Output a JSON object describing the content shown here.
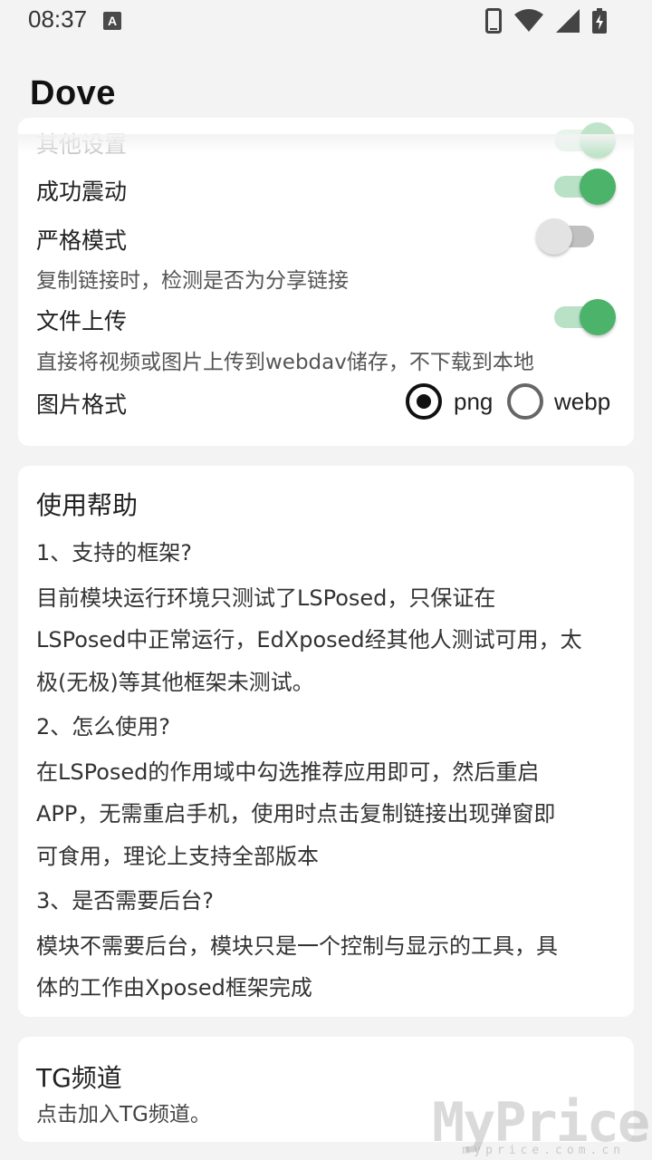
{
  "status_bar": {
    "time": "08:37",
    "notification_badge": "A",
    "icons": [
      "phone-icon",
      "wifi-icon",
      "signal-icon",
      "battery-charging-icon"
    ]
  },
  "app_bar": {
    "title": "Dove"
  },
  "settings": {
    "cut_off_label": "其他设置",
    "success_vibrate": {
      "label": "成功震动",
      "enabled": true
    },
    "strict_mode": {
      "label": "严格模式",
      "description": "复制链接时，检测是否为分享链接",
      "enabled": false
    },
    "file_upload": {
      "label": "文件上传",
      "description": "直接将视频或图片上传到webdav储存，不下载到本地",
      "enabled": true
    },
    "image_format": {
      "label": "图片格式",
      "options": [
        "png",
        "webp"
      ],
      "selected": "png"
    }
  },
  "help": {
    "title": "使用帮助",
    "lines": [
      "1、支持的框架?",
      "目前模块运行环境只测试了LSPosed，只保证在",
      "LSPosed中正常运行，EdXposed经其他人测试可用，太",
      "极(无极)等其他框架未测试。",
      "2、怎么使用?",
      "在LSPosed的作用域中勾选推荐应用即可，然后重启",
      "APP，无需重启手机，使用时点击复制链接出现弹窗即",
      "可食用，理论上支持全部版本",
      "3、是否需要后台?",
      "模块不需要后台，模块只是一个控制与显示的工具，具",
      "体的工作由Xposed框架完成"
    ]
  },
  "tg": {
    "title": "TG频道",
    "subtitle": "点击加入TG频道。"
  },
  "watermark": {
    "brand": "MyPrice",
    "url": "myprice.com.cn"
  },
  "colors": {
    "accent": "#4cb36a",
    "background": "#f3f3f3",
    "card": "#ffffff"
  }
}
